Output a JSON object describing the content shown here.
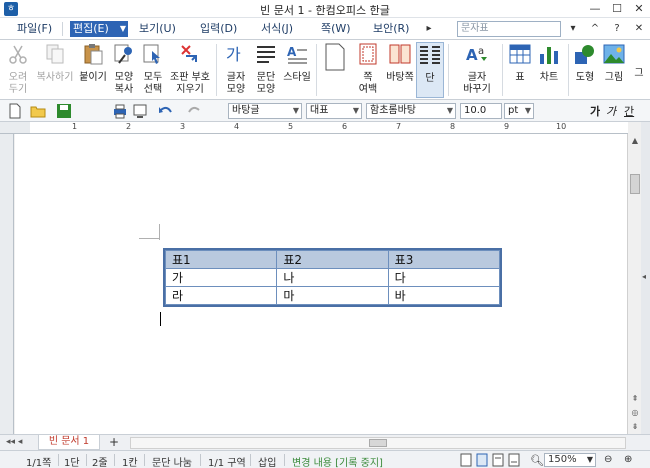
{
  "window": {
    "title": "빈 문서 1 - 한컴오피스 한글",
    "app_icon": "ㅎ",
    "minimize": "—",
    "maximize": "☐",
    "close": "✕"
  },
  "menu": {
    "items": [
      {
        "label": "파일(F)"
      },
      {
        "label": "편집(E)",
        "active": true
      },
      {
        "label": "보기(U)"
      },
      {
        "label": "입력(D)"
      },
      {
        "label": "서식(J)"
      },
      {
        "label": "쪽(W)"
      },
      {
        "label": "보안(R)"
      }
    ],
    "nav_more": "▸",
    "search_placeholder": "문자표",
    "extras": [
      "▾",
      "^",
      "?"
    ],
    "close_doc": "✕"
  },
  "ribbon": {
    "buttons": [
      {
        "label": "오려\n두기",
        "icon": "scissors-icon",
        "disabled": true
      },
      {
        "label": "복사하기",
        "icon": "copy-icon",
        "disabled": true
      },
      {
        "label": "붙이기",
        "icon": "paste-icon",
        "dropdown": true
      },
      {
        "label": "모양\n복사",
        "icon": "format-painter-icon"
      },
      {
        "label": "모두\n선택",
        "icon": "select-all-icon"
      },
      {
        "label": "조판 부호\n지우기",
        "icon": "clear-format-icon"
      },
      {
        "label": "글자\n모양",
        "icon": "char-shape-icon"
      },
      {
        "label": "문단\n모양",
        "icon": "para-shape-icon"
      },
      {
        "label": "스타일",
        "icon": "style-icon",
        "dropdown": true
      },
      {
        "label": "",
        "icon": "page-icon"
      },
      {
        "label": "쪽\n여백",
        "icon": "page-margin-icon",
        "dropdown": true
      },
      {
        "label": "바탕쪽",
        "icon": "master-page-icon"
      },
      {
        "label": "단",
        "icon": "columns-icon",
        "dropdown": true,
        "selected": true
      },
      {
        "label": "글자\n바꾸기",
        "icon": "char-replace-icon",
        "dropdown": true
      },
      {
        "label": "표",
        "icon": "table-icon",
        "dropdown": true
      },
      {
        "label": "차트",
        "icon": "chart-icon"
      },
      {
        "label": "도형",
        "icon": "shape-icon",
        "dropdown": true
      },
      {
        "label": "그림",
        "icon": "picture-icon",
        "dropdown": true
      },
      {
        "label": "그",
        "icon": "more-icon"
      }
    ]
  },
  "toolbar": {
    "style_combo": "바탕글",
    "outline_combo": "대표",
    "font_combo": "함초롬바탕",
    "size_combo": "10.0",
    "unit_combo": "pt",
    "font_chars": [
      "가",
      "가",
      "간"
    ]
  },
  "ruler": {
    "numbers": [
      "1",
      "2",
      "3",
      "4",
      "5",
      "6",
      "7",
      "8",
      "9",
      "10"
    ]
  },
  "document": {
    "table": {
      "headers": [
        "표1",
        "표2",
        "표3"
      ],
      "rows": [
        [
          "가",
          "나",
          "다"
        ],
        [
          "라",
          "마",
          "바"
        ]
      ]
    }
  },
  "tabs": {
    "doc_tab": "빈 문서 1",
    "add_tab": "+"
  },
  "statusbar": {
    "page": "1/1쪽",
    "column": "1단",
    "line": "2줄",
    "col_pos": "1칸",
    "para_split": "문단 나눔",
    "section": "1/1 구역",
    "insert": "삽입",
    "track_changes": "변경 내용 [기록 중지]",
    "zoom": "150%"
  }
}
